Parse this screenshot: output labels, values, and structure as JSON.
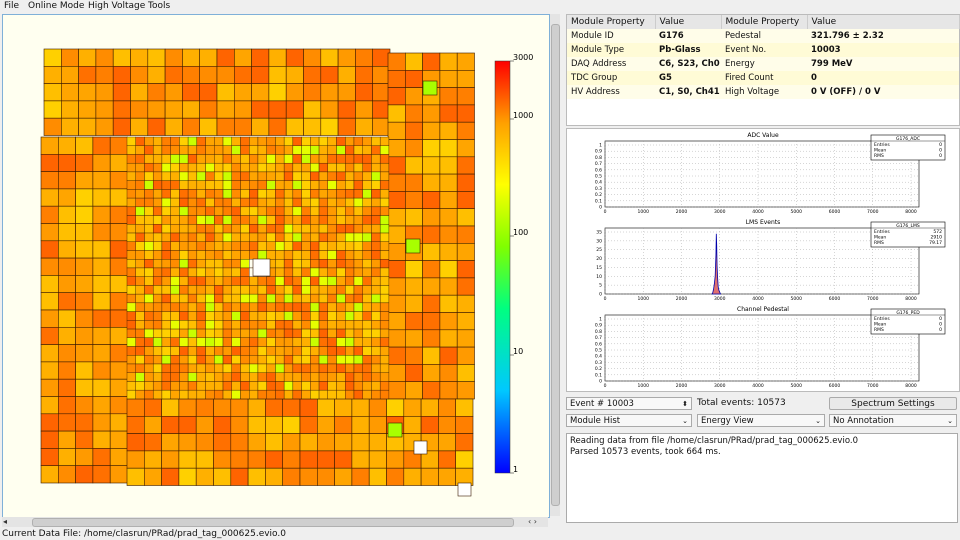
{
  "menu": [
    "File",
    "Online Mode",
    "High Voltage",
    "Tools"
  ],
  "colorbar": {
    "labels": [
      "3000",
      "1000",
      "100",
      "10",
      "1"
    ]
  },
  "properties": {
    "headers": [
      "Module Property",
      "Value",
      "Module Property",
      "Value"
    ],
    "rows": [
      {
        "k1": "Module ID",
        "v1": "G176",
        "k2": "Pedestal",
        "v2": "321.796 ± 2.32"
      },
      {
        "k1": "Module Type",
        "v1": "Pb-Glass",
        "k2": "Event No.",
        "v2": "10003"
      },
      {
        "k1": "DAQ Address",
        "v1": "C6, S23, Ch0",
        "k2": "Energy",
        "v2": "799 MeV"
      },
      {
        "k1": "TDC Group",
        "v1": "G5",
        "k2": "Fired Count",
        "v2": "0"
      },
      {
        "k1": "HV Address",
        "v1": "C1, S0, Ch41",
        "k2": "High Voltage",
        "v2": "0 V (OFF) / 0 V"
      }
    ]
  },
  "histograms": [
    {
      "title": "ADC Value",
      "stats_name": "G176_ADC",
      "entries": "0",
      "mean": "0",
      "rms": "0",
      "yticks": [
        "0",
        "0.1",
        "0.2",
        "0.3",
        "0.4",
        "0.5",
        "0.6",
        "0.7",
        "0.8",
        "0.9",
        "1"
      ]
    },
    {
      "title": "LMS Events",
      "stats_name": "G176_LMS",
      "entries": "572",
      "mean": "2910",
      "rms": "79.17",
      "yticks": [
        "0",
        "5",
        "10",
        "15",
        "20",
        "25",
        "30",
        "35"
      ]
    },
    {
      "title": "Channel Pedestal",
      "stats_name": "G176_PED",
      "entries": "0",
      "mean": "0",
      "rms": "0",
      "yticks": [
        "0",
        "0.1",
        "0.2",
        "0.3",
        "0.4",
        "0.5",
        "0.6",
        "0.7",
        "0.8",
        "0.9",
        "1"
      ]
    }
  ],
  "xticks": [
    "0",
    "1000",
    "2000",
    "3000",
    "4000",
    "5000",
    "6000",
    "7000",
    "8000"
  ],
  "stat_labels": {
    "entries": "Entries",
    "mean": "Mean",
    "rms": "RMS"
  },
  "controls": {
    "event_value": "Event # 10003",
    "total_events": "Total events: 10573",
    "spectrum_button": "Spectrum Settings",
    "view_select": "Module Hist",
    "energy_select": "Energy View",
    "annotation_select": "No Annotation"
  },
  "log": [
    "Reading data from file /home/clasrun/PRad/prad_tag_000625.evio.0",
    "Parsed 10573 events, took 664 ms."
  ],
  "status": "Current Data File: /home/clasrun/PRad/prad_tag_000625.evio.0",
  "colors": {
    "low": "#ffa500",
    "mid": "#ff7f00",
    "high": "#ff4000",
    "green": "#80ff00"
  }
}
